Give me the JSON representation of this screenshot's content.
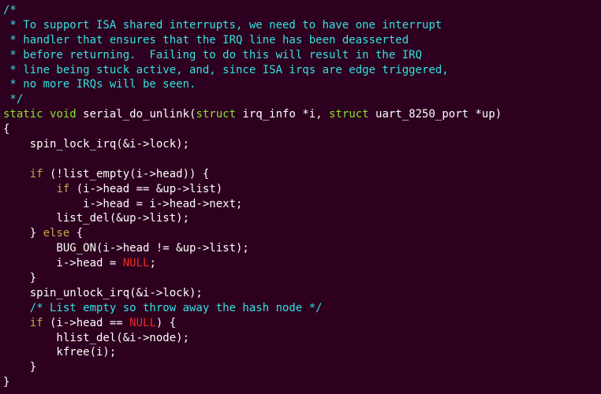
{
  "comment_lines": [
    "/*",
    " * To support ISA shared interrupts, we need to have one interrupt",
    " * handler that ensures that the IRQ line has been deasserted",
    " * before returning.  Failing to do this will result in the IRQ",
    " * line being stuck active, and, since ISA irqs are edge triggered,",
    " * no more IRQs will be seen.",
    " */"
  ],
  "sig": {
    "kw_static": "static",
    "kw_void": "void",
    "fn_name": " serial_do_unlink(",
    "kw_struct1": "struct",
    "param1": " irq_info *i, ",
    "kw_struct2": "struct",
    "param2": " uart_8250_port *up)"
  },
  "body": {
    "open_brace": "{",
    "l1": "    spin_lock_irq(&i->lock);",
    "blank1": "",
    "l2a": "    ",
    "l2_if": "if",
    "l2b": " (!list_empty(i->head)) {",
    "l3a": "        ",
    "l3_if": "if",
    "l3b": " (i->head == &up->list)",
    "l4": "            i->head = i->head->next;",
    "l5": "        list_del(&up->list);",
    "l6a": "    } ",
    "l6_else": "else",
    "l6b": " {",
    "l7": "        BUG_ON(i->head != &up->list);",
    "l8a": "        i->head = ",
    "l8_null": "NULL",
    "l8b": ";",
    "l9": "    }",
    "l10": "    spin_unlock_irq(&i->lock);",
    "l11": "    /* List empty so throw away the hash node */",
    "l12a": "    ",
    "l12_if": "if",
    "l12b": " (i->head == ",
    "l12_null": "NULL",
    "l12c": ") {",
    "l13": "        hlist_del(&i->node);",
    "l14": "        kfree(i);",
    "l15": "    }",
    "close_brace": "}"
  }
}
